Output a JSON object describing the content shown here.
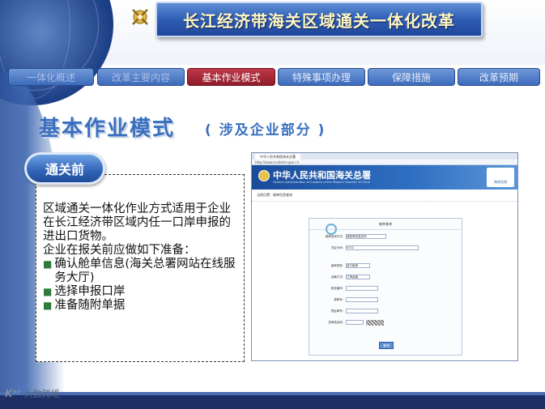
{
  "header": {
    "title": "长江经济带海关区域通关一体化改革"
  },
  "nav": {
    "tabs": [
      {
        "label": "一体化概述",
        "state": "dim"
      },
      {
        "label": "改革主要内容",
        "state": "dim"
      },
      {
        "label": "基本作业模式",
        "state": "active"
      },
      {
        "label": "特殊事项办理",
        "state": "normal"
      },
      {
        "label": "保障措施",
        "state": "normal"
      },
      {
        "label": "改革预期",
        "state": "normal"
      }
    ]
  },
  "section": {
    "title": "基本作业模式",
    "subtitle": "( 涉及企业部分 )"
  },
  "panel": {
    "pill_label": "通关前",
    "paragraph_1": "区域通关一体化作业方式适用于企业在长江经济带区域内任一口岸申报的进出口货物。",
    "paragraph_2": "企业在报关前应做如下准备：",
    "bullets": [
      "确认舱单信息(海关总署网站在线服务大厅)",
      "选择申报口岸",
      "准备随附单据"
    ]
  },
  "browser": {
    "tab_title": "中华人民共和国海关总署",
    "address": "http://www.customs.gov.cn",
    "banner_title": "中华人民共和国海关总署",
    "banner_en": "General Administration of Customs of the People's Republic of China",
    "right_logo": "海关在线",
    "breadcrumb": "当前位置：舱单信息查询",
    "form_title": "舱单查询",
    "rows": [
      {
        "label": "舱单查询方式:",
        "value": "按舱单信息查询"
      },
      {
        "label": "关区代码:",
        "value": "0202"
      },
      {
        "label": "舱单类型:",
        "value": "进口舱单"
      },
      {
        "label": "运输方式:",
        "value": "江海运输"
      },
      {
        "label": "航班编号:",
        "value": ""
      },
      {
        "label": "提单号:",
        "value": ""
      },
      {
        "label": "提运单号:",
        "value": ""
      },
      {
        "label": "查询验证码:",
        "value": ""
      }
    ],
    "submit_label": "查询"
  },
  "footer": {
    "logo_mark": "K⁵⁰",
    "logo_text": "大数跨境"
  },
  "colors": {
    "title_bg": "#2f5db5",
    "title_text": "#fff7c2",
    "tab_active": "#8f1b29",
    "heading": "#3a6fbf"
  }
}
